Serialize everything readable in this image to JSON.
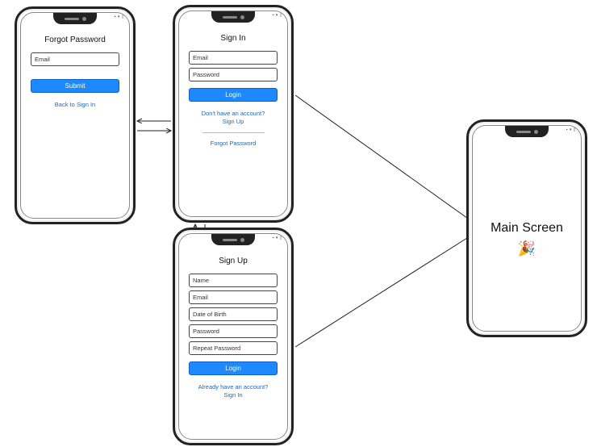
{
  "forgot": {
    "title": "Forgot Password",
    "email": "Email",
    "submit": "Submit",
    "back": "Back to Sign In"
  },
  "signin": {
    "title": "Sign In",
    "email": "Email",
    "password": "Password",
    "login": "Login",
    "signup_prompt": "Don't have an account?\nSign Up",
    "forgot_link": "Forgot Password"
  },
  "signup": {
    "title": "Sign Up",
    "name": "Name",
    "email": "Email",
    "dob": "Date of Birth",
    "password": "Password",
    "repeat": "Repeat Password",
    "login": "Login",
    "signin_prompt": "Already have an account?\nSign In"
  },
  "main": {
    "title": "Main Screen",
    "emoji": "🎉"
  },
  "status_bar": "▪ ▾ ▯"
}
